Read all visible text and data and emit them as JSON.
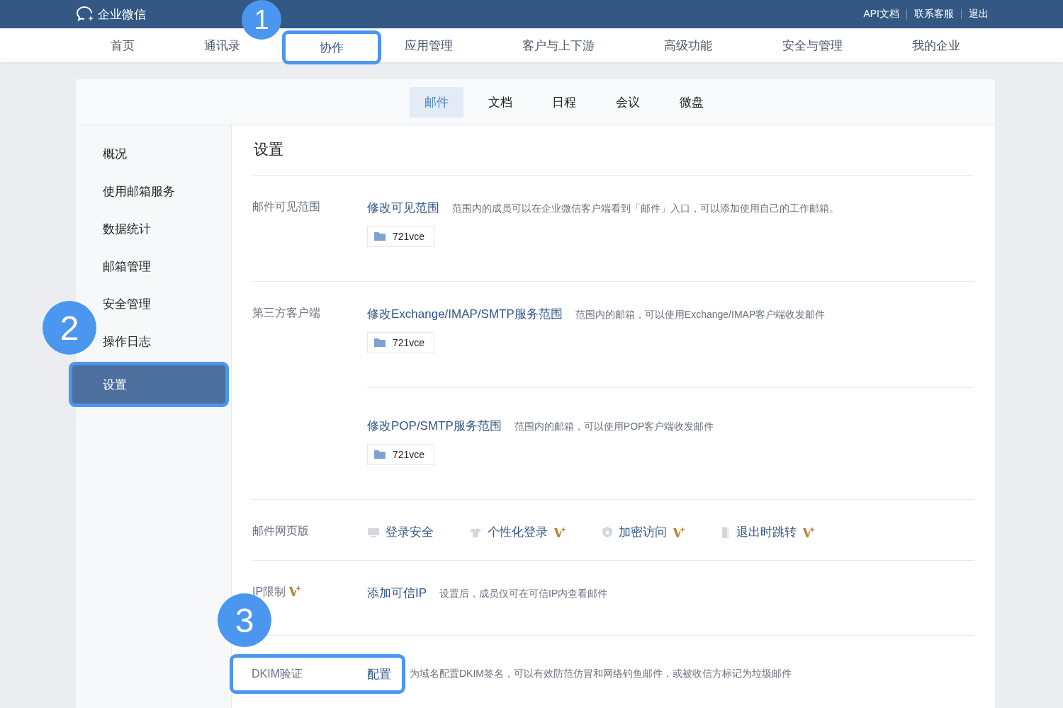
{
  "header": {
    "logo": "企业微信",
    "links": [
      "API文档",
      "联系客服",
      "退出"
    ]
  },
  "nav": [
    {
      "label": "首页",
      "selected": false
    },
    {
      "label": "通讯录",
      "selected": false
    },
    {
      "label": "协作",
      "selected": true,
      "callout": "1"
    },
    {
      "label": "应用管理",
      "selected": false
    },
    {
      "label": "客户与上下游",
      "selected": false
    },
    {
      "label": "高级功能",
      "selected": false
    },
    {
      "label": "安全与管理",
      "selected": false
    },
    {
      "label": "我的企业",
      "selected": false
    }
  ],
  "subtabs": [
    {
      "label": "邮件",
      "selected": true
    },
    {
      "label": "文档",
      "selected": false
    },
    {
      "label": "日程",
      "selected": false
    },
    {
      "label": "会议",
      "selected": false
    },
    {
      "label": "微盘",
      "selected": false
    }
  ],
  "sidebar": [
    {
      "label": "概况",
      "selected": false
    },
    {
      "label": "使用邮箱服务",
      "selected": false
    },
    {
      "label": "数据统计",
      "selected": false
    },
    {
      "label": "邮箱管理",
      "selected": false
    },
    {
      "label": "安全管理",
      "selected": false
    },
    {
      "label": "操作日志",
      "selected": false
    },
    {
      "label": "设置",
      "selected": true,
      "callout": "2"
    }
  ],
  "page_title": "设置",
  "sections": [
    {
      "label": "邮件可见范围",
      "items": [
        {
          "kind": "link",
          "link": "修改可见范围",
          "description": "范围内的成员可以在企业微信客户端看到「邮件」入口，可以添加使用自己的工作邮箱。",
          "scope": "721vce"
        }
      ]
    },
    {
      "label": "第三方客户端",
      "items": [
        {
          "kind": "link",
          "link": "修改Exchange/IMAP/SMTP服务范围",
          "description": "范围内的邮箱，可以使用Exchange/IMAP客户端收发邮件",
          "scope": "721vce"
        },
        {
          "kind": "link",
          "link": "修改POP/SMTP服务范围",
          "description": "范围内的邮箱，可以使用POP客户端收发邮件",
          "scope": "721vce"
        }
      ]
    },
    {
      "label": "邮件网页版",
      "items": [
        {
          "kind": "features",
          "features": [
            {
              "label": "登录安全",
              "premium": false
            },
            {
              "label": "个性化登录",
              "premium": true
            },
            {
              "label": "加密访问",
              "premium": true
            },
            {
              "label": "退出时跳转",
              "premium": true
            }
          ]
        }
      ]
    },
    {
      "label": "IP限制",
      "premium": true,
      "items": [
        {
          "kind": "link",
          "link": "添加可信IP",
          "description": "设置后，成员仅可在可信IP内查看邮件"
        }
      ]
    },
    {
      "label": "DKIM验证",
      "callout": "3",
      "items": [
        {
          "kind": "link",
          "link": "配置",
          "description": "为域名配置DKIM签名，可以有效防范仿冒和网络钓鱼邮件，或被收信方标记为垃圾邮件"
        }
      ]
    }
  ]
}
